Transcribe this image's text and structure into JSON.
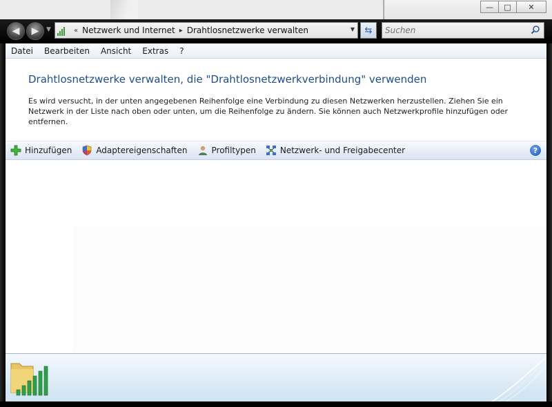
{
  "window": {
    "caption": {
      "minimize": "—",
      "maximize": "□",
      "close": "✕"
    }
  },
  "navigation": {
    "back_icon": "back-arrow-icon",
    "forward_icon": "forward-arrow-icon",
    "breadcrumb_prefix": "«",
    "breadcrumb": [
      "Netzwerk und Internet",
      "Drahtlosnetzwerke verwalten"
    ],
    "separator": "▸",
    "search_placeholder": "Suchen"
  },
  "menu": [
    "Datei",
    "Bearbeiten",
    "Ansicht",
    "Extras",
    "?"
  ],
  "main": {
    "heading": "Drahtlosnetzwerke verwalten, die \"Drahtlosnetzwerkverbindung\" verwenden",
    "description": "Es wird versucht, in der unten angegebenen Reihenfolge eine Verbindung zu diesen Netzwerken herzustellen. Ziehen Sie ein Netzwerk in der Liste nach oben oder unten, um die Reihenfolge zu ändern. Sie können auch Netzwerkprofile hinzufügen oder entfernen."
  },
  "commands": [
    {
      "label": "Hinzufügen",
      "icon": "plus-icon"
    },
    {
      "label": "Adaptereigenschaften",
      "icon": "shield-icon"
    },
    {
      "label": "Profiltypen",
      "icon": "user-icon"
    },
    {
      "label": "Netzwerk- und Freigabecenter",
      "icon": "network-icon"
    }
  ],
  "colors": {
    "heading": "#1e4e8c",
    "accent_green": "#3a9a3a"
  }
}
